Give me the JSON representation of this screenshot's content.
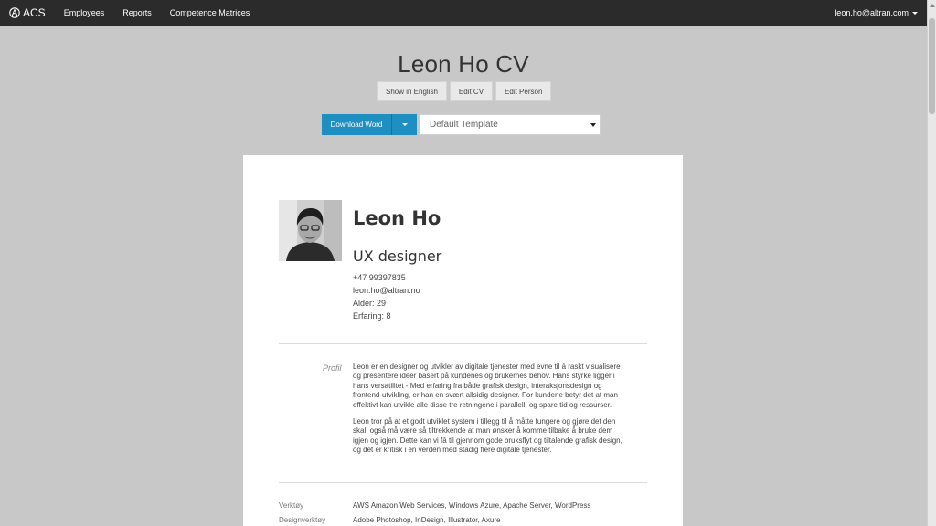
{
  "nav": {
    "brand": "ACS",
    "links": [
      "Employees",
      "Reports",
      "Competence Matrices"
    ],
    "user": "leon.ho@altran.com"
  },
  "page": {
    "title": "Leon Ho CV",
    "buttons": [
      "Show in English",
      "Edit CV",
      "Edit Person"
    ],
    "download_label": "Download Word",
    "template_selected": "Default Template",
    "accent_color": "#1f8fc2"
  },
  "cv": {
    "name": "Leon Ho",
    "role": "UX designer",
    "phone": "+47 99397835",
    "email": "leon.ho@altran.no",
    "age": "Alder: 29",
    "experience": "Erfaring: 8",
    "profile_label": "Profil",
    "profile_p1": "Leon er en designer og utvikler av digitale tjenester med evne til å raskt visualisere og presentere ideer basert på kundenes og brukernes behov. Hans styrke ligger i hans versatilitet - Med erfaring fra både grafisk design, interaksjonsdesign og frontend-utvikling, er han en svært allsidig designer. For kundene betyr det at man effektivt kan utvikle alle disse tre retningene i parallell, og spare tid og ressurser.",
    "profile_p2": "Leon tror på at et godt utviklet system i tillegg til å måtte fungere og gjøre det den skal, også må være så tiltrekkende at man ønsker å komme tilbake å bruke dem igjen og igjen. Dette kan vi få til gjennom gode bruksflyt og tiltalende grafisk design, og det er kritisk i en verden med stadig flere digitale tjenester.",
    "skills": [
      {
        "label": "Verktøy",
        "value": "AWS Amazon Web Services, Windows Azure, Apache Server, WordPress"
      },
      {
        "label": "Designverktøy",
        "value": "Adobe Photoshop, InDesign, Illustrator, Axure"
      }
    ]
  }
}
